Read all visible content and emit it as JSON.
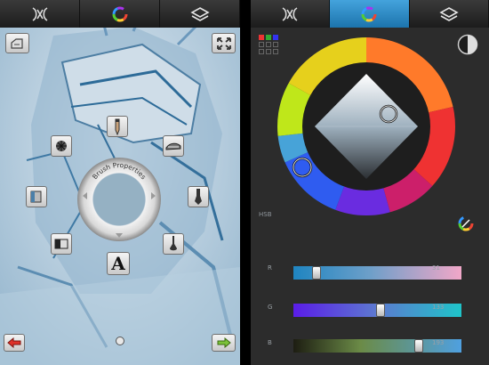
{
  "left_panel": {
    "tabs": [
      "brush-library-icon",
      "color-wheel-icon",
      "layers-icon"
    ],
    "brush_properties_label": "Brush Properties",
    "text_tool_glyph": "A",
    "tools": [
      "undo-icon",
      "fullscreen-icon",
      "pencil-icon",
      "airbrush-icon",
      "smudge-icon",
      "marker-icon",
      "eraser-icon",
      "ink-brush-icon",
      "paint-brush-icon",
      "text-tool-icon",
      "fill-icon",
      "brush-previous-icon",
      "brush-next-icon"
    ]
  },
  "right_panel": {
    "tabs": [
      "brush-library-icon",
      "color-wheel-icon",
      "layers-icon"
    ],
    "selected_tab": "color-wheel-icon",
    "mode_label": "HSB",
    "current_color": "#7fb5de",
    "sliders": [
      {
        "label": "R",
        "value": "31",
        "fraction": 0.12
      },
      {
        "label": "G",
        "value": "133",
        "fraction": 0.52
      },
      {
        "label": "B",
        "value": "193",
        "fraction": 0.76
      }
    ]
  }
}
